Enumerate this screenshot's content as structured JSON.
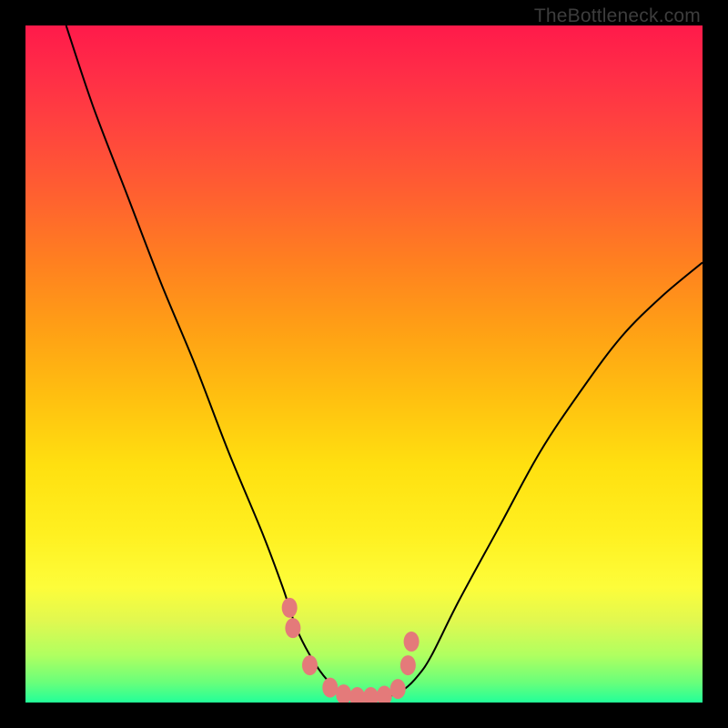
{
  "watermark": "TheBottleneck.com",
  "chart_data": {
    "type": "line",
    "title": "",
    "xlabel": "",
    "ylabel": "",
    "xlim": [
      0,
      100
    ],
    "ylim": [
      0,
      100
    ],
    "grid": false,
    "legend": false,
    "series": [
      {
        "name": "curve",
        "x": [
          6,
          10,
          15,
          20,
          25,
          30,
          35,
          38,
          40,
          42,
          44,
          46,
          48,
          50,
          52,
          54,
          56,
          58,
          60,
          64,
          70,
          76,
          82,
          88,
          94,
          100
        ],
        "y": [
          100,
          88,
          75,
          62,
          50,
          37,
          25,
          17,
          11,
          7,
          4,
          2,
          1,
          0.5,
          0.5,
          1,
          2,
          4,
          7,
          15,
          26,
          37,
          46,
          54,
          60,
          65
        ]
      }
    ],
    "markers": {
      "name": "highlight-points",
      "x": [
        39,
        39.5,
        42,
        45,
        47,
        49,
        51,
        53,
        55,
        56.5,
        57
      ],
      "y": [
        14,
        11,
        5.5,
        2.2,
        1.2,
        0.8,
        0.8,
        1.0,
        2.0,
        5.5,
        9
      ]
    },
    "colors": {
      "gradient_top": "#ff1a4a",
      "gradient_bottom": "#22ff99",
      "curve": "#000000",
      "marker": "#e47a7a",
      "background": "#000000"
    },
    "annotations": [
      "TheBottleneck.com"
    ]
  }
}
